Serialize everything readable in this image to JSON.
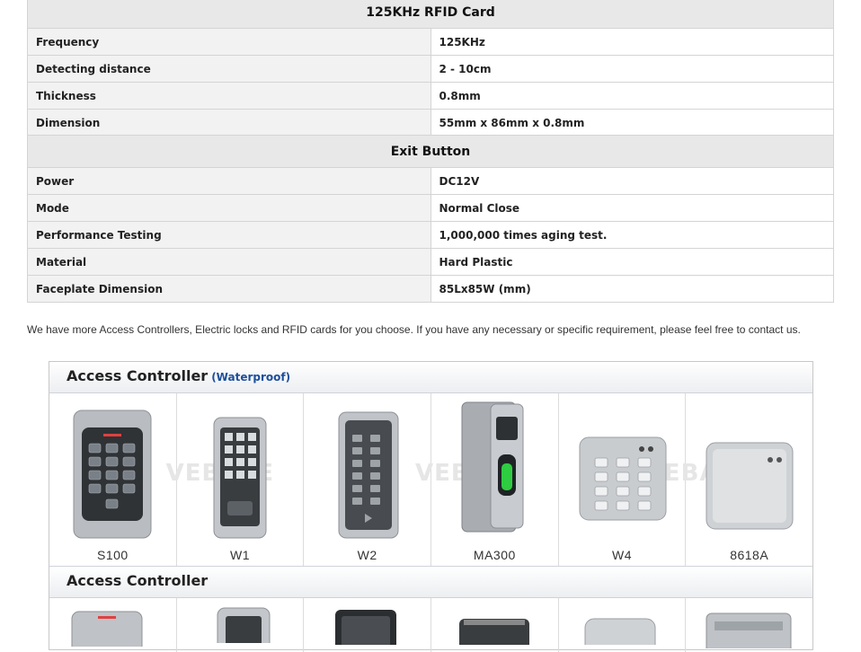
{
  "card_table": {
    "title": "125KHz RFID Card",
    "rows": [
      {
        "k": "Frequency",
        "v": "125KHz"
      },
      {
        "k": "Detecting distance",
        "v": "2 - 10cm"
      },
      {
        "k": "Thickness",
        "v": "0.8mm"
      },
      {
        "k": "Dimension",
        "v": "55mm x 86mm x 0.8mm"
      }
    ]
  },
  "exit_table": {
    "title": "Exit Button",
    "rows": [
      {
        "k": "Power",
        "v": "DC12V"
      },
      {
        "k": "Mode",
        "v": "Normal Close"
      },
      {
        "k": "Performance Testing",
        "v": "1,000,000 times aging test."
      },
      {
        "k": "Material",
        "v": "Hard Plastic"
      },
      {
        "k": "Faceplate Dimension",
        "v": "85Lx85W (mm)"
      }
    ]
  },
  "note": "We have more Access Controllers, Electric locks and RFID cards for you choose. If you have any necessary or specific requirement, please feel free to contact us.",
  "section1": {
    "title": "Access Controller",
    "subtitle": "(Waterproof)",
    "products": [
      {
        "name": "S100",
        "icon": "keypad-controller-icon"
      },
      {
        "name": "W1",
        "icon": "narrow-keypad-icon"
      },
      {
        "name": "W2",
        "icon": "keypad-reader-icon"
      },
      {
        "name": "MA300",
        "icon": "fingerprint-reader-icon"
      },
      {
        "name": "W4",
        "icon": "square-keypad-icon"
      },
      {
        "name": "8618A",
        "icon": "card-reader-icon"
      }
    ]
  },
  "section2": {
    "title": "Access Controller"
  },
  "watermark": "VEBASE",
  "colors": {
    "accent": "#1c4f9b",
    "header_bg": "#e8e8e8",
    "key_bg": "#f2f2f2"
  }
}
